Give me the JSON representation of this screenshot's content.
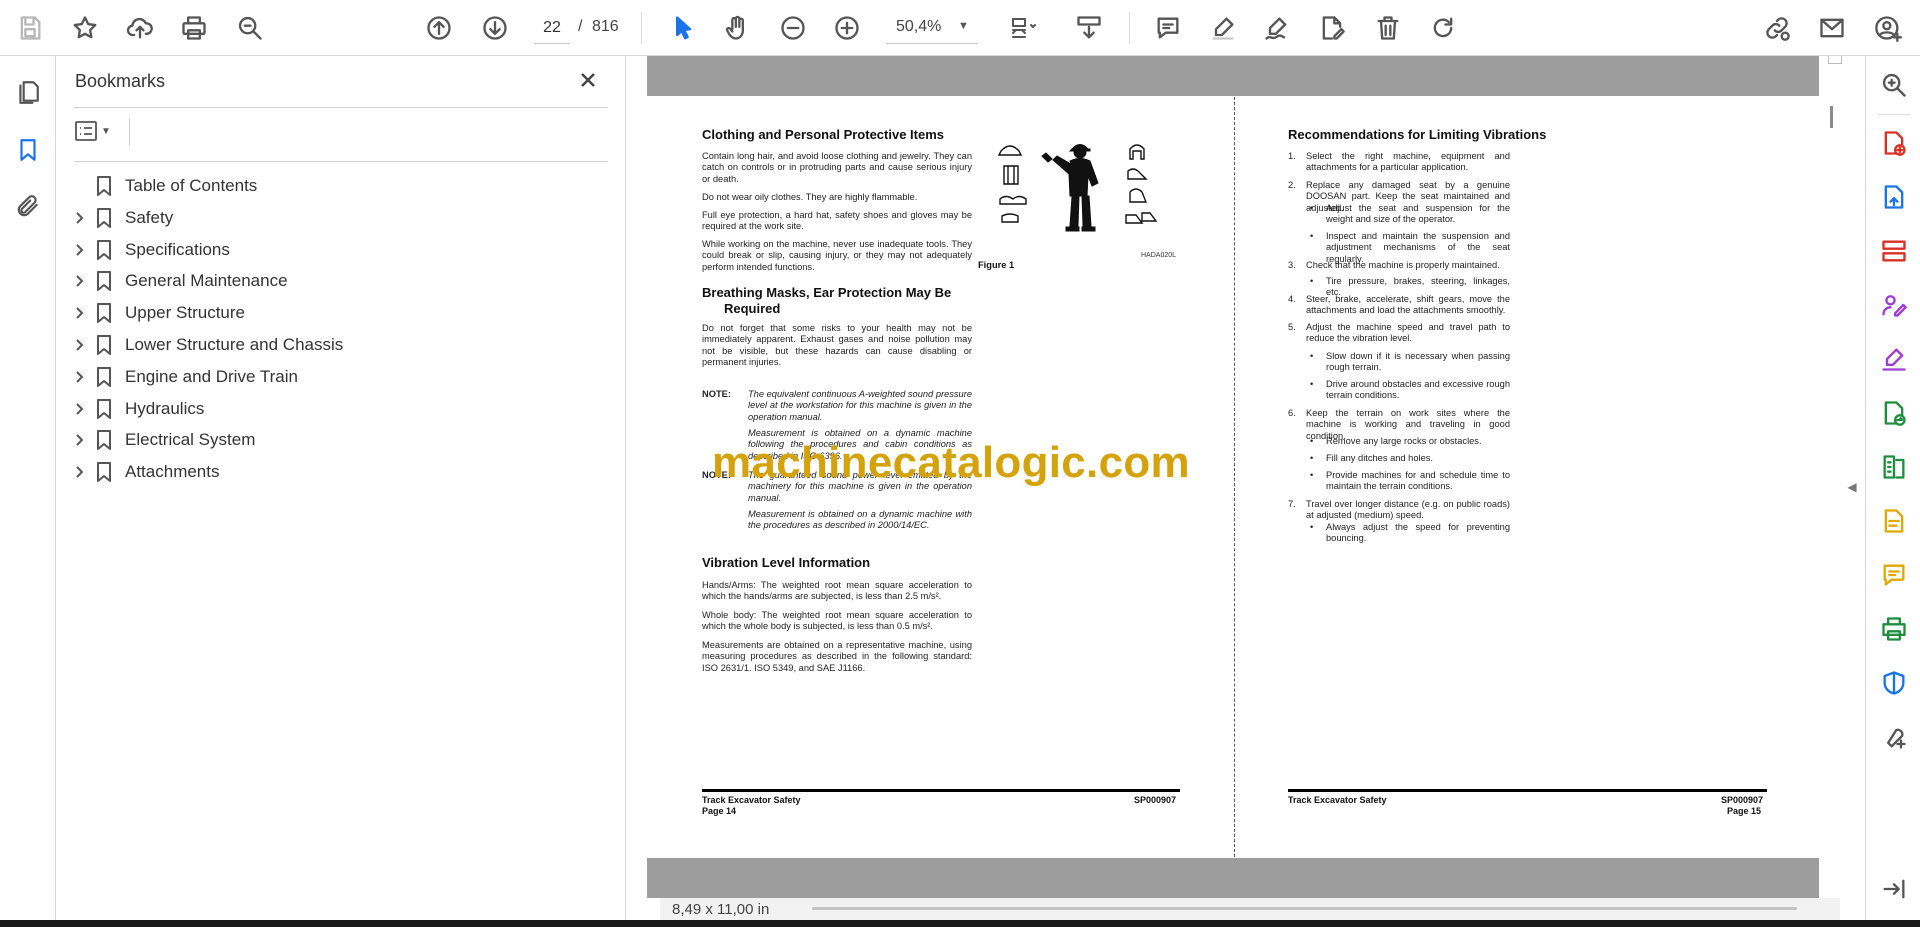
{
  "toolbar": {
    "page_current": "22",
    "page_separator": "/",
    "page_total": "816",
    "zoom": "50,4%",
    "icons": [
      "save-icon",
      "bookmark-star-icon",
      "upload-icon",
      "print-icon",
      "zoom-search-icon",
      "page-up-icon",
      "page-down-icon",
      "zoom-out-icon",
      "zoom-in-icon",
      "select-cursor-icon",
      "hand-icon",
      "fit-page-icon",
      "scroll-mode-icon",
      "comment-icon",
      "highlight-icon",
      "sign-icon",
      "edit-pdf-icon",
      "delete-icon",
      "rotate-icon",
      "share-link-icon",
      "email-icon",
      "account-icon"
    ]
  },
  "bookmarks": {
    "title": "Bookmarks",
    "items": [
      {
        "label": "Table of Contents",
        "expandable": false
      },
      {
        "label": "Safety",
        "expandable": true
      },
      {
        "label": "Specifications",
        "expandable": true
      },
      {
        "label": "General Maintenance",
        "expandable": true
      },
      {
        "label": "Upper Structure",
        "expandable": true
      },
      {
        "label": "Lower Structure and Chassis",
        "expandable": true
      },
      {
        "label": "Engine and Drive Train",
        "expandable": true
      },
      {
        "label": "Hydraulics",
        "expandable": true
      },
      {
        "label": "Electrical System",
        "expandable": true
      },
      {
        "label": "Attachments",
        "expandable": true
      }
    ]
  },
  "document": {
    "page_size": "8,49 x 11,00 in",
    "watermark": "machinecatalogic.com",
    "left_page": {
      "h1": "Clothing and Personal Protective Items",
      "p1": "Contain long hair, and avoid loose clothing and jewelry. They can catch on controls or in protruding parts and cause serious injury or death.",
      "p2": "Do not wear oily clothes. They are highly flammable.",
      "p3": "Full eye protection, a hard hat, safety shoes and gloves may be required at the work site.",
      "p4": "While working on the machine, never use inadequate tools. They could break or slip, causing injury, or they may not adequately perform intended functions.",
      "figure_caption": "Figure 1",
      "figure_code": "HADA020L",
      "h2_line1": "Breathing Masks, Ear Protection May Be",
      "h2_line2": "Required",
      "p5": "Do not forget that some risks to your health may not be immediately apparent. Exhaust gases and noise pollution may not be visible, but these hazards can cause disabling or permanent injuries.",
      "note_label": "NOTE:",
      "note1a": "The equivalent continuous A-weighted sound pressure level at the workstation for this machine is given in the operation manual.",
      "note1b": "Measurement is obtained on a dynamic machine following the procedures and cabin conditions as described in ISO 6396.",
      "note2a": "The guaranteed sound power level emitted by the machinery for this machine is given in the operation manual.",
      "note2b": "Measurement is obtained on a dynamic machine with the procedures as described in 2000/14/EC.",
      "h3": "Vibration Level Information",
      "p6": "Hands/Arms: The weighted root mean square acceleration to which the hands/arms are subjected, is less than 2.5 m/s².",
      "p7": "Whole body: The weighted root mean square acceleration to which the whole body is subjected, is less than 0.5 m/s².",
      "p8": "Measurements are obtained on a representative machine, using measuring procedures as described in the following standard: ISO 2631/1. ISO 5349, and SAE J1166.",
      "footer_title": "Track Excavator Safety",
      "footer_page": "Page 14",
      "footer_code": "SP000907"
    },
    "right_page": {
      "h1": "Recommendations for Limiting Vibrations",
      "items": [
        {
          "num": "1.",
          "text": "Select the right machine, equipment and attachments for a particular application."
        },
        {
          "num": "2.",
          "text": "Replace any damaged seat by a genuine DOOSAN part. Keep the seat maintained and adjusted."
        },
        {
          "num": "•",
          "text": "Adjust the seat and suspension for the weight and size of the operator."
        },
        {
          "num": "•",
          "text": "Inspect and maintain the suspension and adjustment mechanisms of the seat regularly."
        },
        {
          "num": "3.",
          "text": "Check that the machine is properly maintained."
        },
        {
          "num": "•",
          "text": "Tire pressure, brakes, steering, linkages, etc."
        },
        {
          "num": "4.",
          "text": "Steer, brake, accelerate, shift gears, move the attachments and load the attachments smoothly."
        },
        {
          "num": "5.",
          "text": "Adjust the machine speed and travel path to reduce the vibration level."
        },
        {
          "num": "•",
          "text": "Slow down if it is necessary when passing rough terrain."
        },
        {
          "num": "•",
          "text": "Drive around obstacles and excessive rough terrain conditions."
        },
        {
          "num": "6.",
          "text": "Keep the terrain on work sites where the machine is working and traveling in good condition."
        },
        {
          "num": "•",
          "text": "Remove any large rocks or obstacles."
        },
        {
          "num": "•",
          "text": "Fill any ditches and holes."
        },
        {
          "num": "•",
          "text": "Provide machines for and schedule time to maintain the terrain conditions."
        },
        {
          "num": "7.",
          "text": "Travel over longer distance (e.g. on public roads) at adjusted (medium) speed."
        },
        {
          "num": "•",
          "text": "Always adjust the speed for preventing bouncing."
        }
      ],
      "footer_title": "Track Excavator Safety",
      "footer_page": "Page 15",
      "footer_code": "SP000907"
    }
  },
  "colors": {
    "accent": "#1a73e8",
    "watermark": "#d4a20a",
    "tool_red": "#d93025",
    "tool_blue": "#1a73e8",
    "tool_purple": "#9c3bd6",
    "tool_green": "#1e8e3e",
    "tool_yellow": "#e0a800"
  }
}
